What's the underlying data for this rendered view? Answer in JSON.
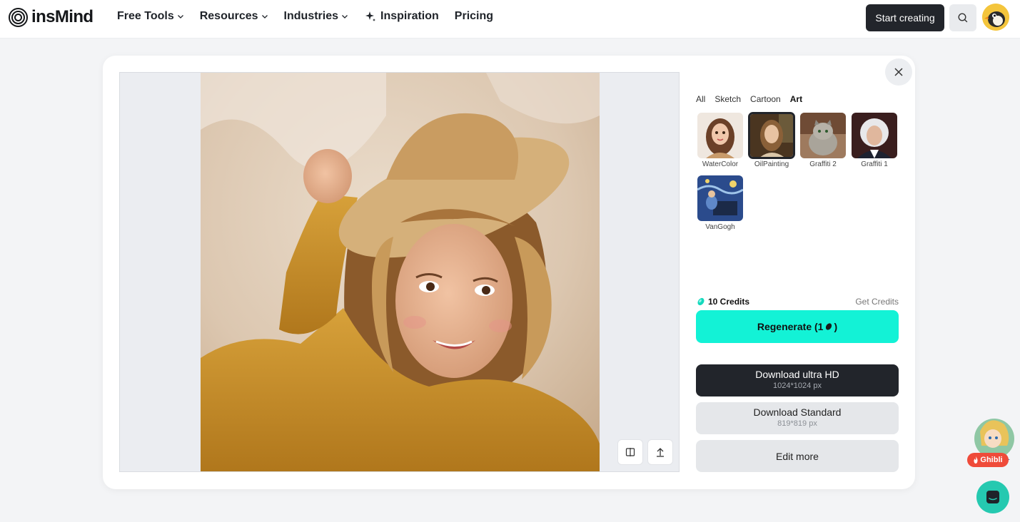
{
  "header": {
    "logo_text": "insMind",
    "nav": [
      {
        "label": "Free Tools",
        "has_dropdown": true
      },
      {
        "label": "Resources",
        "has_dropdown": true
      },
      {
        "label": "Industries",
        "has_dropdown": true
      },
      {
        "label": "Inspiration",
        "icon": "sparkle-icon"
      },
      {
        "label": "Pricing"
      }
    ],
    "start_label": "Start creating"
  },
  "categories": [
    "All",
    "Sketch",
    "Cartoon",
    "Art"
  ],
  "active_category": "Art",
  "styles": [
    {
      "label": "WaterColor"
    },
    {
      "label": "OilPainting",
      "selected": true
    },
    {
      "label": "Graffiti 2"
    },
    {
      "label": "Graffiti 1"
    },
    {
      "label": "VanGogh"
    }
  ],
  "credits": {
    "label": "10 Credits",
    "get": "Get Credits"
  },
  "regenerate": {
    "label": "Regenerate (1",
    "suffix": ")"
  },
  "download_hd": {
    "title": "Download ultra HD",
    "size": "1024*1024 px"
  },
  "download_std": {
    "title": "Download Standard",
    "size": "819*819 px"
  },
  "edit_more": "Edit more",
  "ghibli_badge": "Ghibli",
  "colors": {
    "accent": "#13f2d6",
    "dark": "#22252b",
    "chat": "#25c9b0",
    "badge": "#ef4b3a"
  }
}
